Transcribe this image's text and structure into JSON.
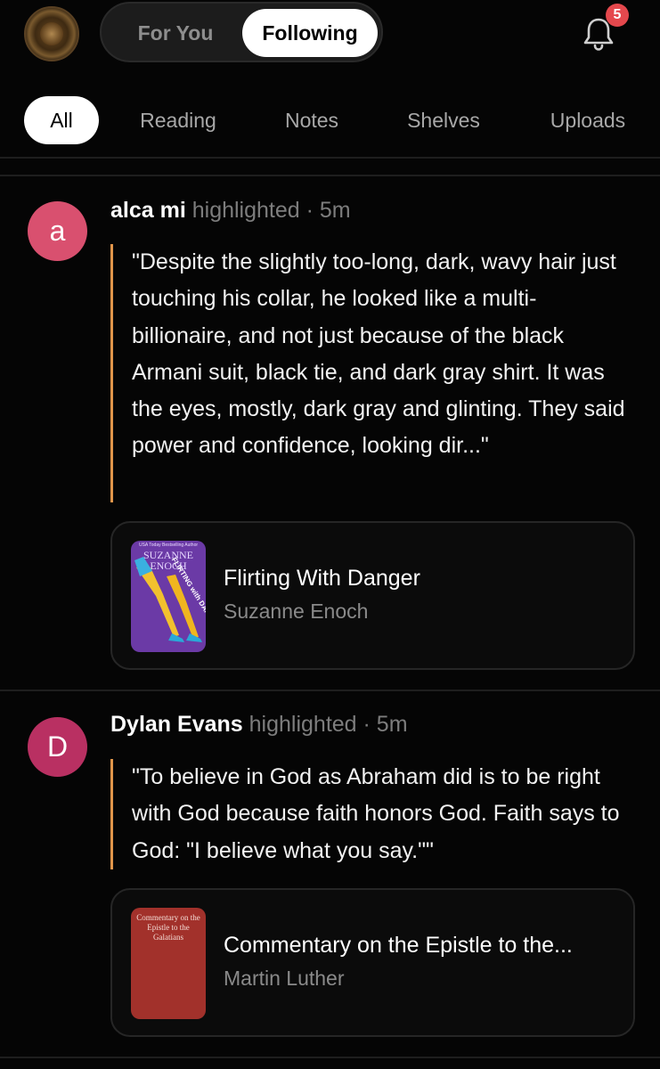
{
  "header": {
    "tabs": [
      {
        "label": "For You",
        "active": false
      },
      {
        "label": "Following",
        "active": true
      }
    ],
    "notifications_badge": "5"
  },
  "filters": [
    {
      "label": "All",
      "active": true
    },
    {
      "label": "Reading",
      "active": false
    },
    {
      "label": "Notes",
      "active": false
    },
    {
      "label": "Shelves",
      "active": false
    },
    {
      "label": "Uploads",
      "active": false
    }
  ],
  "posts": [
    {
      "avatar_letter": "a",
      "avatar_color": "#d9506f",
      "user": "alca mi",
      "action": "highlighted · 5m",
      "quote": "\"Despite the slightly too-long, dark, wavy hair just touching his collar, he looked like a multi-billionaire, and not just because of the black Armani suit, black tie, and dark gray shirt. It was the eyes, mostly, dark gray and glinting. They said power and confidence, looking dir...\"",
      "book": {
        "title": "Flirting With Danger",
        "author": "Suzanne Enoch",
        "cover_tagline": "USA Today Bestselling Author",
        "cover_author": "SUZANNE ENOCH",
        "cover_title": "FLIRTING with DANGER",
        "cover_color": "#6b3aa6"
      }
    },
    {
      "avatar_letter": "D",
      "avatar_color": "#b93062",
      "user": "Dylan Evans",
      "action": "highlighted · 5m",
      "quote": "\"To believe in God as Abraham did is to be right with God because faith honors God. Faith says to God: \"I believe what you say.\"\"",
      "book": {
        "title": "Commentary on the Epistle to the...",
        "author": "Martin Luther",
        "cover_text": "Commentary on the Epistle to the Galatians",
        "cover_color": "#a2312b"
      }
    }
  ],
  "icons": {
    "profile": "profile-avatar",
    "notifications": "bell-icon"
  },
  "colors": {
    "accent_quote_bar": "#e0954a",
    "badge": "#e5484d"
  }
}
